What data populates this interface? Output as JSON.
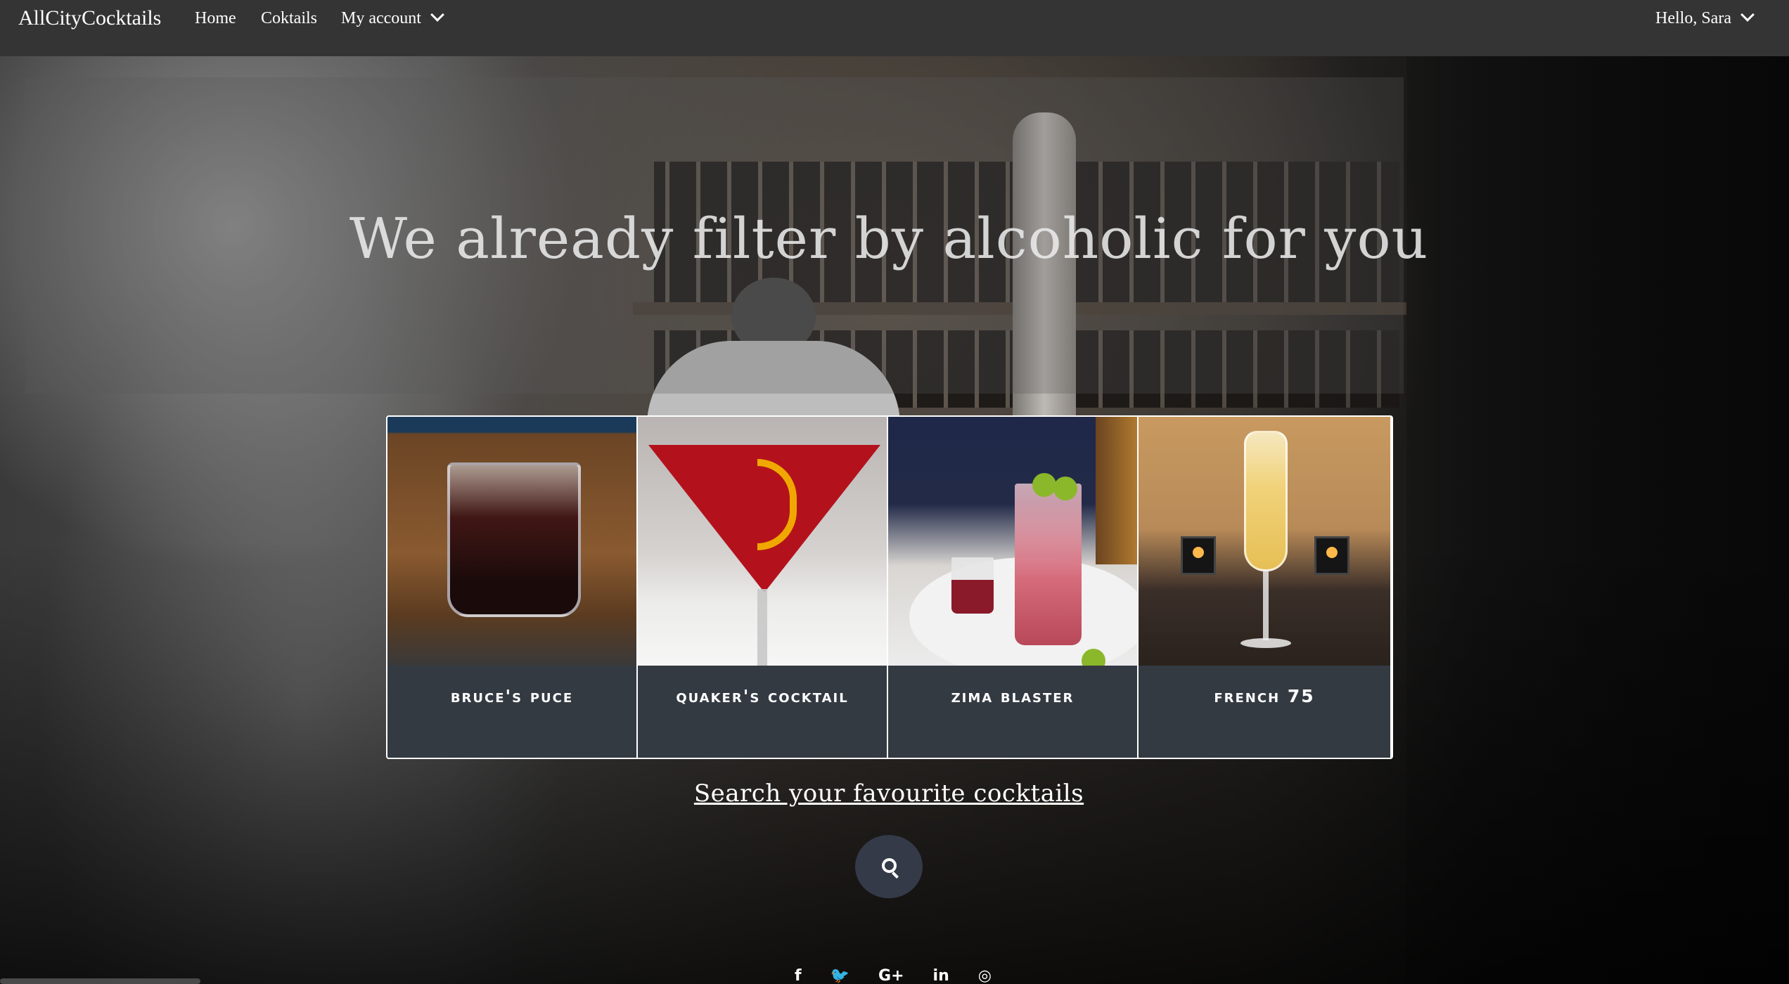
{
  "navbar": {
    "brand": "AllCityCocktails",
    "links": [
      {
        "label": "Home"
      },
      {
        "label": "Coktails"
      },
      {
        "label": "My account"
      }
    ],
    "user_menu": "Hello, Sara"
  },
  "hero": {
    "title": "We already filter by alcoholic for you"
  },
  "cocktails": [
    {
      "name": "Bruce's Puce"
    },
    {
      "name": "Quaker's Cocktail"
    },
    {
      "name": "Zima Blaster"
    },
    {
      "name": "French 75"
    }
  ],
  "search": {
    "link_text": "Search your favourite cocktails",
    "button_icon": "search-icon"
  },
  "social": {
    "icons": [
      "facebook-icon",
      "twitter-icon",
      "google-plus-icon",
      "linkedin-icon",
      "dribbble-icon"
    ],
    "glyphs": [
      "f",
      "🐦",
      "G+",
      "in",
      "◎"
    ]
  },
  "colors": {
    "navbar_bg": "#343434",
    "card_label_bg": "#343a42",
    "search_button_bg": "#343a48"
  }
}
